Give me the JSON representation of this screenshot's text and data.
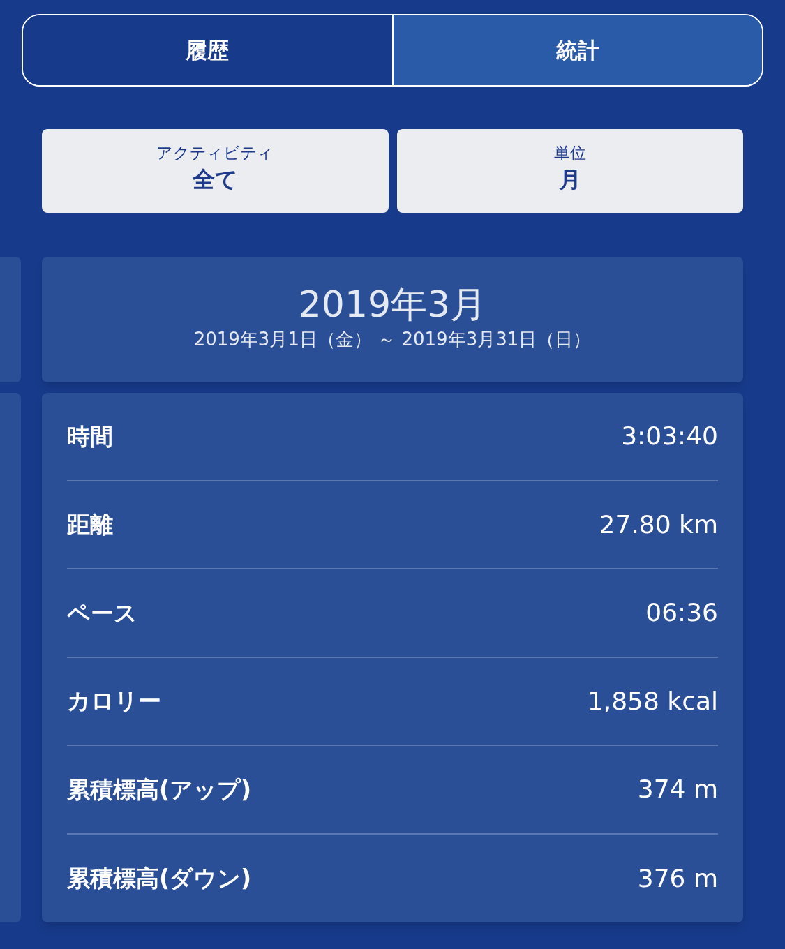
{
  "tabs": [
    {
      "label": "履歴",
      "selected": false
    },
    {
      "label": "統計",
      "selected": true
    }
  ],
  "filters": [
    {
      "label": "アクティビティ",
      "value": "全て"
    },
    {
      "label": "単位",
      "value": "月"
    }
  ],
  "period": {
    "title": "2019年3月",
    "range": "2019年3月1日（金） ～ 2019年3月31日（日）"
  },
  "stats": [
    {
      "label": "時間",
      "value": "3:03:40"
    },
    {
      "label": "距離",
      "value": "27.80 km"
    },
    {
      "label": "ペース",
      "value": "06:36"
    },
    {
      "label": "カロリー",
      "value": "1,858 kcal"
    },
    {
      "label": "累積標高(アップ)",
      "value": "374 m"
    },
    {
      "label": "累積標高(ダウン)",
      "value": "376 m"
    }
  ]
}
